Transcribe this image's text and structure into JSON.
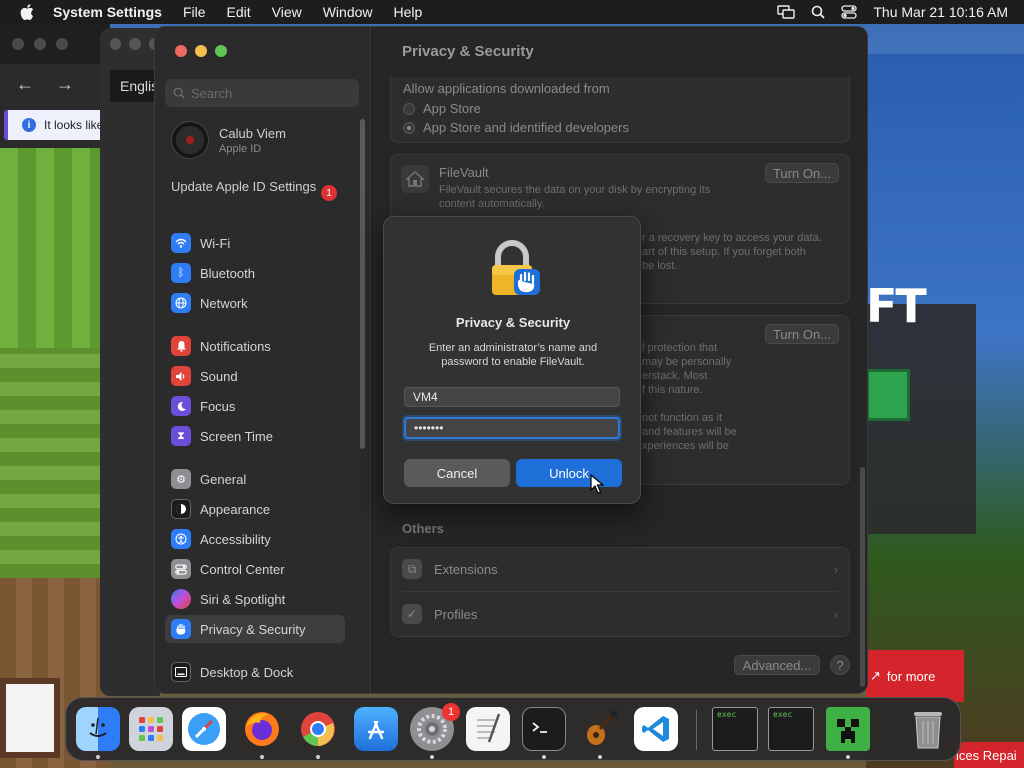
{
  "menubar": {
    "app_name": "System Settings",
    "menus": [
      "File",
      "Edit",
      "View",
      "Window",
      "Help"
    ],
    "clock": "Thu Mar 21  10:16 AM"
  },
  "background": {
    "browser_info_text": "It looks like",
    "language_tab": "Englis",
    "promo_text": "for more",
    "repair_text": "ices Repai"
  },
  "settings": {
    "search_placeholder": "Search",
    "user": {
      "name": "Calub Viem",
      "sub": "Apple ID"
    },
    "update": {
      "label": "Update Apple ID Settings",
      "badge": "1"
    },
    "sidebar_items": [
      {
        "label": "Wi-Fi",
        "icon": "wifi-icon",
        "color": "#2f7df6"
      },
      {
        "label": "Bluetooth",
        "icon": "bluetooth-icon",
        "color": "#2f7df6"
      },
      {
        "label": "Network",
        "icon": "globe-icon",
        "color": "#2f7df6"
      },
      {
        "label": "Notifications",
        "icon": "bell-icon",
        "color": "#e0433a"
      },
      {
        "label": "Sound",
        "icon": "speaker-icon",
        "color": "#e0433a"
      },
      {
        "label": "Focus",
        "icon": "moon-icon",
        "color": "#6b4fd8"
      },
      {
        "label": "Screen Time",
        "icon": "hourglass-icon",
        "color": "#6b4fd8"
      },
      {
        "label": "General",
        "icon": "gear-icon",
        "color": "#8e8e93"
      },
      {
        "label": "Appearance",
        "icon": "appearance-icon",
        "color": "#1c1c1e"
      },
      {
        "label": "Accessibility",
        "icon": "accessibility-icon",
        "color": "#2f7df6"
      },
      {
        "label": "Control Center",
        "icon": "control-center-icon",
        "color": "#8e8e93"
      },
      {
        "label": "Siri & Spotlight",
        "icon": "siri-icon",
        "color": "#c04fd8"
      },
      {
        "label": "Privacy & Security",
        "icon": "hand-icon",
        "color": "#2f7df6"
      },
      {
        "label": "Desktop & Dock",
        "icon": "dock-icon",
        "color": "#1c1c1e"
      }
    ],
    "content": {
      "title": "Privacy & Security",
      "allow_label": "Allow applications downloaded from",
      "radio_app_store": "App Store",
      "radio_identified": "App Store and identified developers",
      "filevault_title": "FileVault",
      "filevault_desc": "FileVault secures the data on your disk by encrypting its content automatically.",
      "turn_on": "Turn On...",
      "recovery_text_1": "r a recovery key to access your data.",
      "recovery_text_2": "art of this setup. If you forget both",
      "recovery_text_3": "be lost.",
      "lockdown_text_1": "l protection that",
      "lockdown_text_2": "may be personally",
      "lockdown_text_3": "erstack. Most",
      "lockdown_text_4": "f this nature.",
      "lockdown_text_5": "not function as it",
      "lockdown_text_6": "and features will be",
      "lockdown_text_7": "xperiences will be",
      "others_label": "Others",
      "extensions_label": "Extensions",
      "profiles_label": "Profiles",
      "advanced_label": "Advanced...",
      "help_label": "?"
    }
  },
  "dialog": {
    "title": "Privacy & Security",
    "message": "Enter an administrator’s name and password to enable FileVault.",
    "username": "VM4",
    "password": "•••••••",
    "cancel_label": "Cancel",
    "unlock_label": "Unlock"
  },
  "dock": {
    "apps": [
      {
        "name": "Finder",
        "icon": "finder-icon"
      },
      {
        "name": "Launchpad",
        "icon": "launchpad-icon"
      },
      {
        "name": "Safari",
        "icon": "safari-icon"
      },
      {
        "name": "Firefox",
        "icon": "firefox-icon"
      },
      {
        "name": "Chrome",
        "icon": "chrome-icon"
      },
      {
        "name": "App Store",
        "icon": "app-store-icon"
      },
      {
        "name": "System Settings",
        "icon": "system-settings-icon",
        "badge": "1"
      },
      {
        "name": "TextEdit",
        "icon": "textedit-icon"
      },
      {
        "name": "Terminal",
        "icon": "terminal-icon"
      },
      {
        "name": "GarageBand",
        "icon": "guitar-icon"
      },
      {
        "name": "VS Code",
        "icon": "vscode-icon"
      },
      {
        "name": "exec",
        "icon": "exec-icon"
      },
      {
        "name": "exec",
        "icon": "exec-icon"
      },
      {
        "name": "Minecraft",
        "icon": "creeper-icon"
      },
      {
        "name": "Trash",
        "icon": "trash-icon"
      }
    ]
  }
}
